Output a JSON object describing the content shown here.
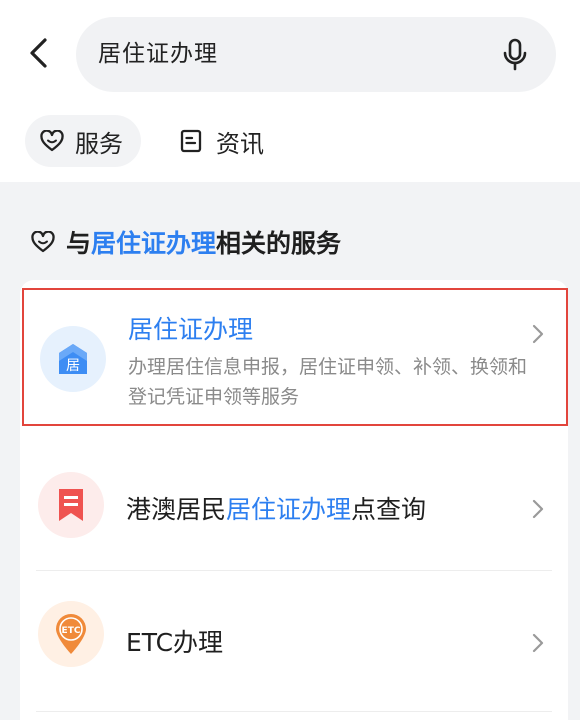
{
  "search": {
    "query": "居住证办理"
  },
  "tabs": [
    {
      "label": "服务",
      "icon": "heart-icon",
      "active": true
    },
    {
      "label": "资讯",
      "icon": "news-icon",
      "active": false
    }
  ],
  "section": {
    "prefix": "与",
    "keyword": "居住证办理",
    "suffix": "相关的服务"
  },
  "results": [
    {
      "title": "居住证办理",
      "description": "办理居住信息申报，居住证申领、补领、换领和登记凭证申领等服务",
      "icon": "residence-icon",
      "icon_glyph": "居",
      "highlighted": true
    },
    {
      "title_prefix": "港澳居民",
      "title_keyword": "居住证办理",
      "title_suffix": "点查询",
      "icon": "bookmark-icon"
    },
    {
      "title": "ETC办理",
      "icon": "etc-icon",
      "icon_glyph": "ETC"
    }
  ],
  "colors": {
    "accent": "#2d7ff0",
    "highlight_border": "#e2453c",
    "description": "#8a8a8a",
    "page_bg": "#f2f3f5"
  }
}
